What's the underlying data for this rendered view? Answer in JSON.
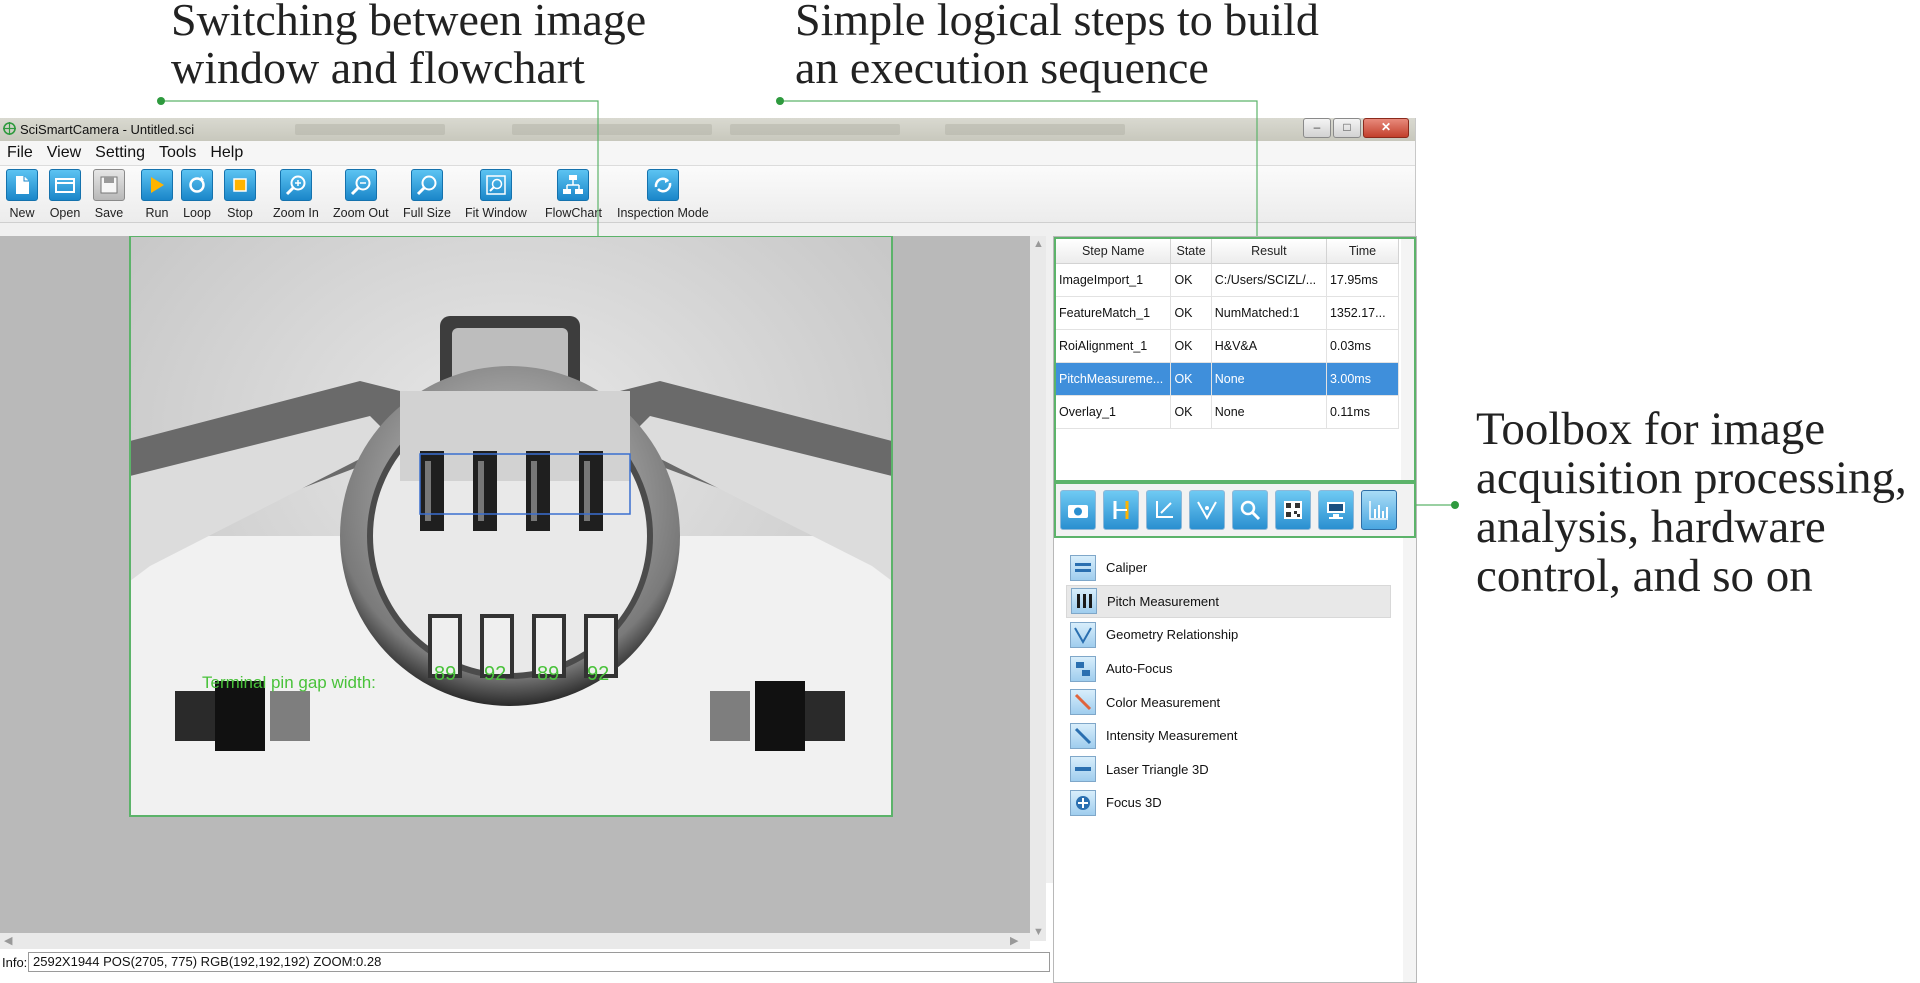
{
  "callouts": {
    "left": "Switching between image\nwindow and flowchart",
    "middle": "Simple logical steps to build\nan execution sequence",
    "right": "Toolbox for image\nacquisition processing,\nanalysis, hardware\ncontrol, and so on"
  },
  "window": {
    "title": "SciSmartCamera - Untitled.sci"
  },
  "menu": [
    "File",
    "View",
    "Setting",
    "Tools",
    "Help"
  ],
  "toolbar": {
    "new": "New",
    "open": "Open",
    "save": "Save",
    "run": "Run",
    "loop": "Loop",
    "stop": "Stop",
    "zoom_in": "Zoom In",
    "zoom_out": "Zoom Out",
    "full_size": "Full Size",
    "fit_window": "Fit Window",
    "flowchart": "FlowChart",
    "inspection_mode": "Inspection Mode"
  },
  "image_overlay": {
    "caption": "Terminal pin gap width:",
    "pitch_values": [
      "89",
      "92",
      "89",
      "92"
    ]
  },
  "info_bar": {
    "label": "Info:",
    "text": "2592X1944  POS(2705, 775)  RGB(192,192,192)  ZOOM:0.28"
  },
  "step_table": {
    "headers": [
      "Step Name",
      "State",
      "Result",
      "Time"
    ],
    "rows": [
      {
        "name": "ImageImport_1",
        "state": "OK",
        "result": "C:/Users/SCIZL/...",
        "time": "17.95ms",
        "selected": false
      },
      {
        "name": "FeatureMatch_1",
        "state": "OK",
        "result": "NumMatched:1",
        "time": "1352.17...",
        "selected": false
      },
      {
        "name": "RoiAlignment_1",
        "state": "OK",
        "result": "H&V&A",
        "time": "0.03ms",
        "selected": false
      },
      {
        "name": "PitchMeasureme...",
        "state": "OK",
        "result": "None",
        "time": "3.00ms",
        "selected": true
      },
      {
        "name": "Overlay_1",
        "state": "OK",
        "result": "None",
        "time": "0.11ms",
        "selected": false
      }
    ]
  },
  "toolbox": {
    "tab_icons": [
      "camera-icon",
      "align-icon",
      "transform-icon",
      "geometry-icon",
      "search-icon",
      "barcode-icon",
      "hardware-icon",
      "measurement-icon"
    ],
    "active_tab": 7,
    "items": [
      {
        "label": "Caliper",
        "icon": "caliper-icon"
      },
      {
        "label": "Pitch Measurement",
        "icon": "pitch-icon"
      },
      {
        "label": "Geometry Relationship",
        "icon": "geometry-icon"
      },
      {
        "label": "Auto-Focus",
        "icon": "autofocus-icon"
      },
      {
        "label": "Color Measurement",
        "icon": "color-icon"
      },
      {
        "label": "Intensity Measurement",
        "icon": "intensity-icon"
      },
      {
        "label": "Laser Triangle 3D",
        "icon": "laser-icon"
      },
      {
        "label": "Focus 3D",
        "icon": "focus3d-icon"
      }
    ],
    "highlighted_item": 1
  },
  "colors": {
    "accent_green": "#5cb36a",
    "overlay_green": "#49c23a",
    "selection_blue": "#3f8fdb",
    "ok_green": "#1e9a1e"
  }
}
